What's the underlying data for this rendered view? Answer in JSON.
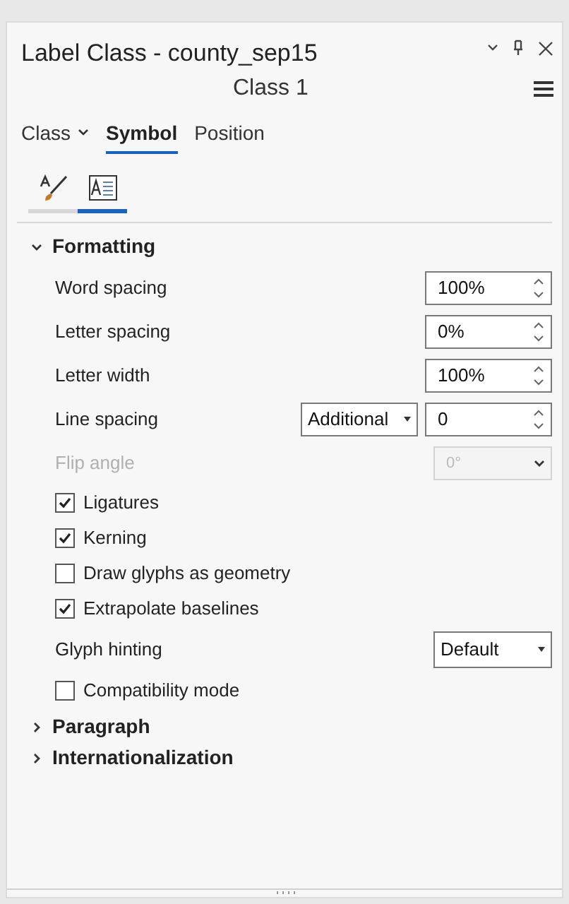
{
  "panel": {
    "title": "Label Class - county_sep15",
    "subtitle": "Class 1"
  },
  "tabs": [
    {
      "label": "Class",
      "kind": "dropdown",
      "selected": false
    },
    {
      "label": "Symbol",
      "kind": "plain",
      "selected": true
    },
    {
      "label": "Position",
      "kind": "plain",
      "selected": false
    }
  ],
  "icon_tabs": [
    {
      "kind": "brush",
      "selected": false
    },
    {
      "kind": "text-frame",
      "selected": true
    }
  ],
  "sections": [
    {
      "title": "Formatting",
      "expanded": true,
      "rows": [
        {
          "kind": "spin",
          "label": "Word spacing",
          "value": "100%",
          "disabled": false
        },
        {
          "kind": "spin",
          "label": "Letter spacing",
          "value": "0%",
          "disabled": false
        },
        {
          "kind": "spin",
          "label": "Letter width",
          "value": "100%",
          "disabled": false
        },
        {
          "kind": "select-spin",
          "label": "Line spacing",
          "option": "Additional",
          "value": "0",
          "disabled": false
        },
        {
          "kind": "combo",
          "label": "Flip angle",
          "value": "0°",
          "disabled": true
        },
        {
          "kind": "checkbox",
          "label": "Ligatures",
          "checked": true,
          "disabled": false
        },
        {
          "kind": "checkbox",
          "label": "Kerning",
          "checked": true,
          "disabled": false
        },
        {
          "kind": "checkbox",
          "label": "Draw glyphs as geometry",
          "checked": false,
          "disabled": false
        },
        {
          "kind": "checkbox",
          "label": "Extrapolate baselines",
          "checked": true,
          "disabled": false
        },
        {
          "kind": "select",
          "label": "Glyph hinting",
          "value": "Default",
          "disabled": false
        },
        {
          "kind": "checkbox",
          "label": "Compatibility mode",
          "checked": false,
          "disabled": false
        }
      ]
    },
    {
      "title": "Paragraph",
      "expanded": false
    },
    {
      "title": "Internationalization",
      "expanded": false
    }
  ]
}
